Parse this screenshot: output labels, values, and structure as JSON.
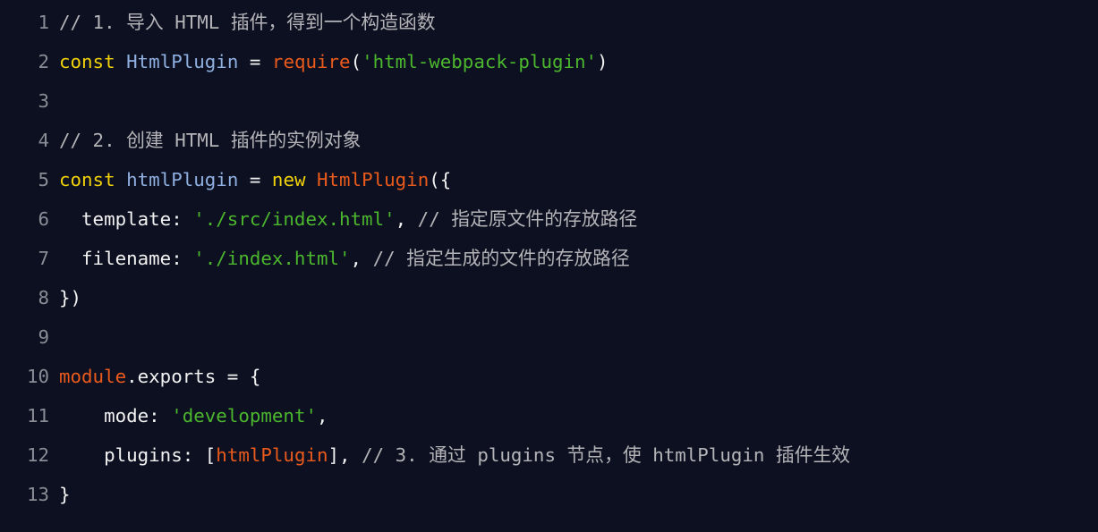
{
  "colors": {
    "background": "#0c1020",
    "comment": "#b4b4b8",
    "keyword": "#f2d20a",
    "identifier": "#8fb0e0",
    "function": "#ea5a1c",
    "string": "#4cb62e",
    "plain": "#f2f2f2",
    "line_number": "#8a8d96"
  },
  "code": {
    "lines": [
      {
        "number": "1",
        "tokens": [
          {
            "type": "comment",
            "text": "// 1. 导入 HTML 插件，得到一个构造函数"
          }
        ]
      },
      {
        "number": "2",
        "tokens": [
          {
            "type": "keyword",
            "text": "const"
          },
          {
            "type": "plain",
            "text": " "
          },
          {
            "type": "ident",
            "text": "HtmlPlugin"
          },
          {
            "type": "plain",
            "text": " = "
          },
          {
            "type": "func",
            "text": "require"
          },
          {
            "type": "plain",
            "text": "("
          },
          {
            "type": "string",
            "text": "'html-webpack-plugin'"
          },
          {
            "type": "plain",
            "text": ")"
          }
        ]
      },
      {
        "number": "3",
        "tokens": []
      },
      {
        "number": "4",
        "tokens": [
          {
            "type": "comment",
            "text": "// 2. 创建 HTML 插件的实例对象"
          }
        ]
      },
      {
        "number": "5",
        "tokens": [
          {
            "type": "keyword",
            "text": "const"
          },
          {
            "type": "plain",
            "text": " "
          },
          {
            "type": "ident",
            "text": "htmlPlugin"
          },
          {
            "type": "plain",
            "text": " = "
          },
          {
            "type": "keyword",
            "text": "new"
          },
          {
            "type": "plain",
            "text": " "
          },
          {
            "type": "func",
            "text": "HtmlPlugin"
          },
          {
            "type": "plain",
            "text": "({"
          }
        ]
      },
      {
        "number": "6",
        "tokens": [
          {
            "type": "plain",
            "text": "  template: "
          },
          {
            "type": "string",
            "text": "'./src/index.html'"
          },
          {
            "type": "plain",
            "text": ", "
          },
          {
            "type": "comment",
            "text": "// 指定原文件的存放路径"
          }
        ]
      },
      {
        "number": "7",
        "tokens": [
          {
            "type": "plain",
            "text": "  filename: "
          },
          {
            "type": "string",
            "text": "'./index.html'"
          },
          {
            "type": "plain",
            "text": ", "
          },
          {
            "type": "comment",
            "text": "// 指定生成的文件的存放路径"
          }
        ]
      },
      {
        "number": "8",
        "tokens": [
          {
            "type": "plain",
            "text": "})"
          }
        ]
      },
      {
        "number": "9",
        "tokens": []
      },
      {
        "number": "10",
        "tokens": [
          {
            "type": "func",
            "text": "module"
          },
          {
            "type": "plain",
            "text": ".exports = {"
          }
        ]
      },
      {
        "number": "11",
        "tokens": [
          {
            "type": "plain",
            "text": "    mode: "
          },
          {
            "type": "string",
            "text": "'development'"
          },
          {
            "type": "plain",
            "text": ","
          }
        ]
      },
      {
        "number": "12",
        "tokens": [
          {
            "type": "plain",
            "text": "    plugins: ["
          },
          {
            "type": "func",
            "text": "htmlPlugin"
          },
          {
            "type": "plain",
            "text": "], "
          },
          {
            "type": "comment",
            "text": "// 3. 通过 plugins 节点，使 htmlPlugin 插件生效"
          }
        ]
      },
      {
        "number": "13",
        "tokens": [
          {
            "type": "plain",
            "text": "}"
          }
        ]
      }
    ]
  }
}
